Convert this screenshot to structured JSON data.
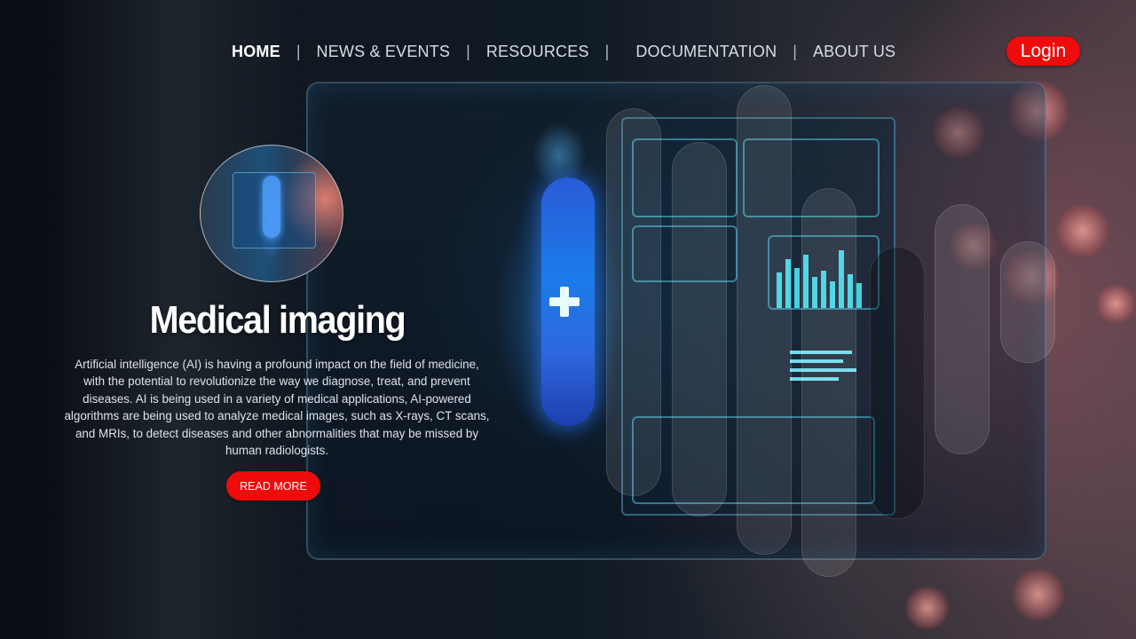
{
  "nav": {
    "items": [
      {
        "label": "HOME",
        "active": true
      },
      {
        "label": "NEWS & EVENTS",
        "active": false
      },
      {
        "label": "RESOURCES",
        "active": false
      },
      {
        "label": "DOCUMENTATION",
        "active": false
      },
      {
        "label": "ABOUT US",
        "active": false
      }
    ],
    "separator": "|",
    "login_label": "Login"
  },
  "hero": {
    "title": "Medical imaging",
    "description": "Artificial intelligence (AI) is having a profound impact on the field of medicine, with the potential to revolutionize the way we diagnose, treat, and prevent diseases. AI is being used in a variety of medical applications, AI-powered algorithms are being used to analyze medical images, such as X-rays, CT scans, and MRIs, to detect diseases and other abnormalities that may be missed by human radiologists.",
    "cta_label": "READ MORE"
  },
  "colors": {
    "accent": "#ee0b0b",
    "text": "#ffffff",
    "nav_text": "#d7dde4",
    "screen_cyan": "#3fd3e2",
    "body_glow": "#2a5bd8"
  },
  "icons": {
    "medical_cross": "medical-cross-icon"
  }
}
